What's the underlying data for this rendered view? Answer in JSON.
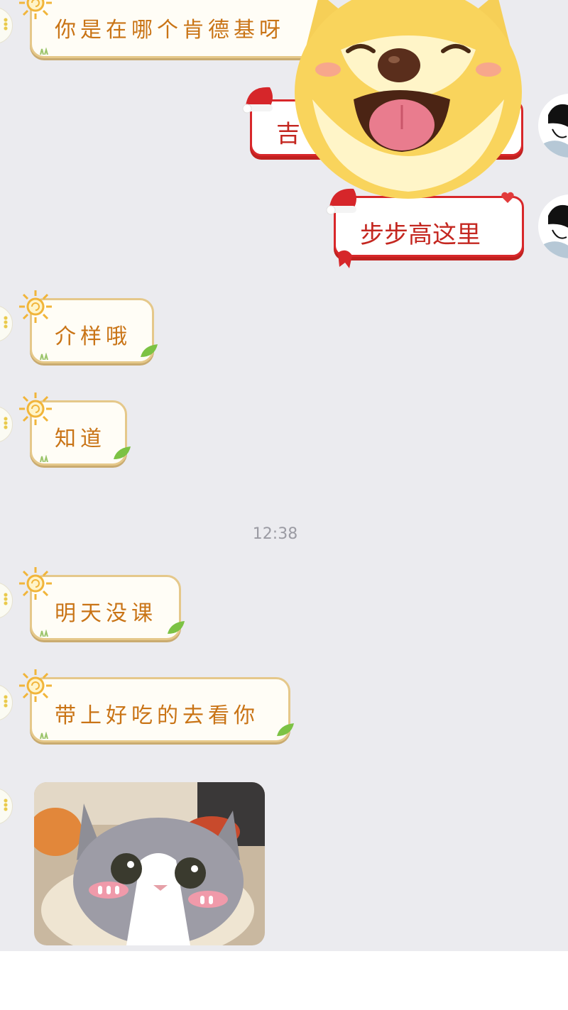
{
  "messages": [
    {
      "side": "left",
      "text": "你是在哪个肯德基呀"
    },
    {
      "side": "right",
      "text": "吉"
    },
    {
      "side": "right",
      "text": "步步高这里"
    },
    {
      "side": "left",
      "text": "介样哦"
    },
    {
      "side": "left",
      "text": "知道"
    },
    {
      "side": "left",
      "text": "明天没课"
    },
    {
      "side": "left",
      "text": "带上好吃的去看你"
    }
  ],
  "timestamp": "12:38",
  "stickers": {
    "dog": "shiba-dog-sticker",
    "cat": "cat-photo"
  },
  "colors": {
    "chat_bg": "#ebebef",
    "left_text": "#c97416",
    "right_border": "#d8272a",
    "timestamp": "#9b9ba3"
  }
}
